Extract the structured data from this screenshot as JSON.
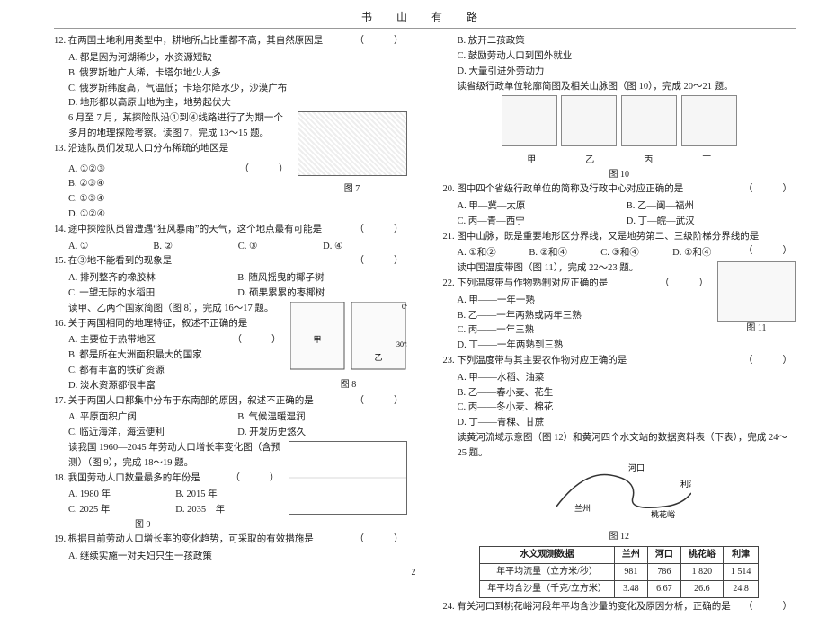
{
  "header": {
    "title": "书 山 有 路"
  },
  "left": {
    "q12": {
      "stem": "12. 在两国土地利用类型中，耕地所占比重都不高，其自然原因是",
      "blank": "（　　）",
      "opts": [
        "A. 都是因为河湖稀少，水资源短缺",
        "B. 俄罗斯地广人稀，卡塔尔地少人多",
        "C. 俄罗斯纬度高，气温低；卡塔尔降水少，沙漠广布",
        "D. 地形都以高原山地为主，地势起伏大"
      ]
    },
    "lead13": "6 月至 7 月，某探险队沿①到④线路进行了为期一个多月的地理探险考察。读图 7，完成 13～15 题。",
    "fig7": "图 7",
    "q13": {
      "stem": "13. 沿途队员们发现人口分布稀疏的地区是",
      "blank": "（　　）",
      "opts": [
        "A. ①②③",
        "B. ②③④",
        "C. ①③④",
        "D. ①②④"
      ]
    },
    "q14": {
      "stem": "14. 途中探险队员曾遭遇“狂风暴雨”的天气，这个地点最有可能是",
      "blank": "（　　）",
      "opts": [
        "A. ①",
        "B. ②",
        "C. ③",
        "D. ④"
      ]
    },
    "q15": {
      "stem": "15. 在③地不能看到的现象是",
      "blank": "（　　）",
      "opts": [
        "A. 排列整齐的橡胶林",
        "B. 随风摇曳的椰子树",
        "C. 一望无际的水稻田",
        "D. 硕果累累的枣椰树"
      ]
    },
    "lead16": "读甲、乙两个国家简图（图 8），完成 16～17 题。",
    "fig8": "图 8",
    "q16": {
      "stem": "16. 关于两国相同的地理特征，叙述不正确的是",
      "blank": "（　　）",
      "opts": [
        "A. 主要位于热带地区",
        "B. 都是所在大洲面积最大的国家",
        "C. 都有丰富的铁矿资源",
        "D. 淡水资源都很丰富"
      ]
    },
    "q17": {
      "stem": "17. 关于两国人口都集中分布于东南部的原因，叙述不正确的是",
      "blank": "（　　）",
      "opts": [
        "A. 平原面积广阔",
        "B. 气候温暖湿润",
        "C. 临近海洋，海运便利",
        "D. 开发历史悠久"
      ]
    },
    "lead18": "读我国 1960—2045 年劳动人口增长率变化图（含预测）（图 9），完成 18～19 题。",
    "fig9": "图 9",
    "q18": {
      "stem": "18. 我国劳动人口数量最多的年份是",
      "blank": "（　　）",
      "opts": [
        "A. 1980 年",
        "B. 2015 年",
        "C. 2025 年",
        "D. 2035　年"
      ]
    },
    "q19": {
      "stem": "19. 根据目前劳动人口增长率的变化趋势，可采取的有效措施是",
      "blank": "（　　）",
      "opts": [
        "A. 继续实施一对夫妇只生一孩政策"
      ]
    }
  },
  "right": {
    "q19cont": [
      "B. 放开二孩政策",
      "C. 鼓励劳动人口到国外就业",
      "D. 大量引进外劳动力"
    ],
    "lead20": "读省级行政单位轮廓简图及相关山脉图（图 10），完成 20～21 题。",
    "fig10": "图 10",
    "fig10labels": [
      "甲",
      "乙",
      "丙",
      "丁"
    ],
    "q20": {
      "stem": "20. 图中四个省级行政单位的简称及行政中心对应正确的是",
      "blank": "（　　）",
      "opts": [
        "A. 甲—冀—太原",
        "B. 乙—闽—福州",
        "C. 丙—青—西宁",
        "D. 丁—皖—武汉"
      ]
    },
    "q21": {
      "stem": "21. 图中山脉，既是重要地形区分界线，又是地势第二、三级阶梯分界线的是",
      "blank": "（　　）",
      "opts": [
        "A. ①和②",
        "B. ②和④",
        "C. ③和④",
        "D. ①和④"
      ]
    },
    "lead22": "读中国温度带图（图 11），完成 22～23 题。",
    "fig11": "图 11",
    "q22": {
      "stem": "22. 下列温度带与作物熟制对应正确的是",
      "blank": "（　　）",
      "opts": [
        "A. 甲——一年一熟",
        "B. 乙——一年两熟或两年三熟",
        "C. 丙——一年三熟",
        "D. 丁——一年两熟到三熟"
      ]
    },
    "q23": {
      "stem": "23. 下列温度带与其主要农作物对应正确的是",
      "blank": "（　　）",
      "opts": [
        "A. 甲——水稻、油菜",
        "B. 乙——春小麦、花生",
        "C. 丙——冬小麦、棉花",
        "D. 丁——青稞、甘蔗"
      ]
    },
    "lead24": "读黄河流域示意图（图 12）和黄河四个水文站的数据资料表（下表），完成 24～25 题。",
    "fig12": "图 12",
    "maplabels": [
      "河口",
      "兰州",
      "桃花峪",
      "利津"
    ],
    "table": {
      "header": [
        "水文观测数据",
        "兰州",
        "河口",
        "桃花峪",
        "利津"
      ],
      "row1": [
        "年平均流量（立方米/秒）",
        "981",
        "786",
        "1 820",
        "1 514"
      ],
      "row2": [
        "年平均含沙量（千克/立方米）",
        "3.48",
        "6.67",
        "26.6",
        "24.8"
      ]
    },
    "q24": {
      "stem": "24. 有关河口到桃花峪河段年平均含沙量的变化及原因分析，正确的是",
      "blank": "（　　）"
    }
  },
  "footer": {
    "page": "2"
  },
  "chart_data": {
    "type": "table",
    "title": "黄河四个水文站数据资料",
    "columns": [
      "兰州",
      "河口",
      "桃花峪",
      "利津"
    ],
    "series": [
      {
        "name": "年平均流量（立方米/秒）",
        "values": [
          981,
          786,
          1820,
          1514
        ]
      },
      {
        "name": "年平均含沙量（千克/立方米）",
        "values": [
          3.48,
          6.67,
          26.6,
          24.8
        ]
      }
    ]
  }
}
